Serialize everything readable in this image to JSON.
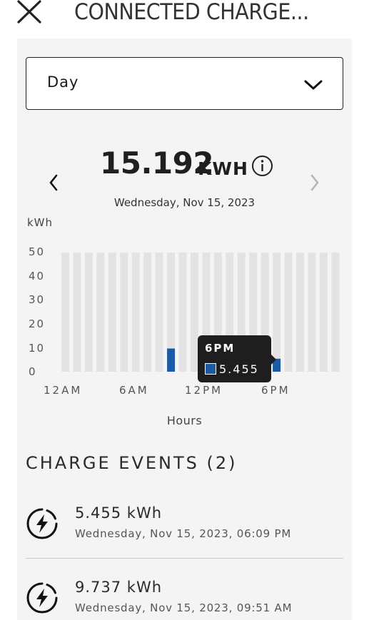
{
  "header": {
    "title": "CONNECTED CHARGE..."
  },
  "period_select": {
    "value": "Day"
  },
  "summary": {
    "total": "15.192",
    "unit": "KWH",
    "date": "Wednesday, Nov 15, 2023"
  },
  "chart_data": {
    "type": "bar",
    "ylabel": "kWh",
    "xlabel": "Hours",
    "ylim": [
      0,
      50
    ],
    "y_ticks": [
      "50",
      "40",
      "30",
      "20",
      "10",
      "0"
    ],
    "x_tick_labels": [
      "12AM",
      "6AM",
      "12PM",
      "6PM"
    ],
    "categories": [
      "12AM",
      "1AM",
      "2AM",
      "3AM",
      "4AM",
      "5AM",
      "6AM",
      "7AM",
      "8AM",
      "9AM",
      "10AM",
      "11AM",
      "12PM",
      "1PM",
      "2PM",
      "3PM",
      "4PM",
      "5PM",
      "6PM",
      "7PM",
      "8PM",
      "9PM",
      "10PM",
      "11PM"
    ],
    "values": [
      0,
      0,
      0,
      0,
      0,
      0,
      0,
      0,
      0,
      9.737,
      0,
      0,
      0,
      0,
      0,
      0,
      0,
      0,
      5.455,
      0,
      0,
      0,
      0,
      0
    ],
    "colors": {
      "bar": "#1c5aa6",
      "background_bar": "#e3e3e3"
    },
    "tooltip": {
      "title": "6PM",
      "value": "5.455"
    }
  },
  "events": {
    "heading": "CHARGE EVENTS (2)",
    "items": [
      {
        "energy": "5.455 kWh",
        "time": "Wednesday, Nov 15, 2023, 06:09 PM",
        "icon": "charge-bolt-icon"
      },
      {
        "energy": "9.737 kWh",
        "time": "Wednesday, Nov 15, 2023, 09:51 AM",
        "icon": "charge-bolt-icon"
      }
    ]
  }
}
